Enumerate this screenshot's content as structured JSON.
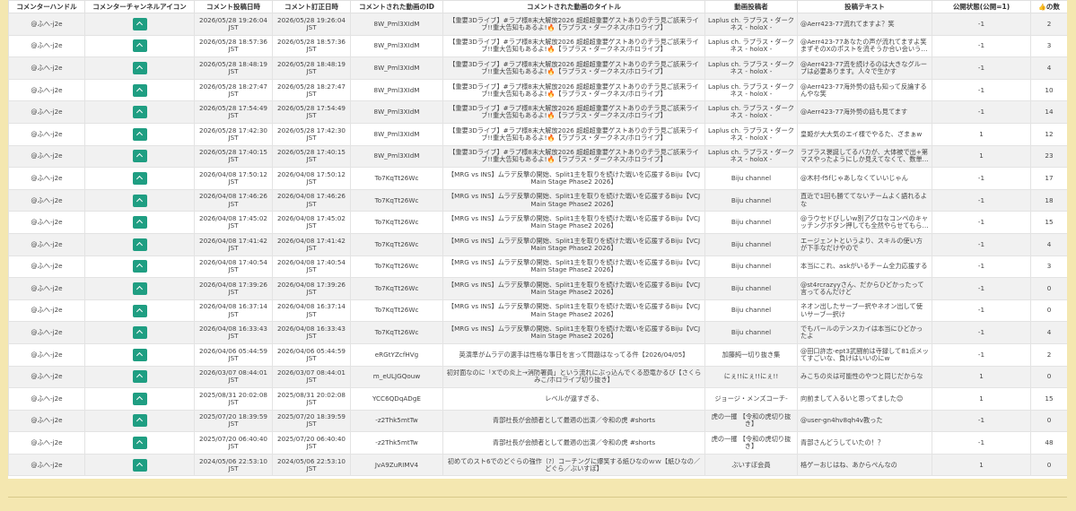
{
  "headers": {
    "handle": "コメンターハンドル",
    "icon": "コメンターチャンネルアイコン",
    "posted": "コメント投稿日時",
    "edited": "コメント訂正日時",
    "video_id": "コメントされた動画のID",
    "video_title": "コメントされた動画のタイトル",
    "uploader": "動画投稿者",
    "text": "投稿テキスト",
    "public": "公開状態(公開=1)",
    "likes_icon": "👍",
    "likes": "の数"
  },
  "rows": [
    {
      "handle": "@ふへ-j2e",
      "posted": "2026/05/28 19:26:04 JST",
      "edited": "2026/05/28 19:26:04 JST",
      "video_id": "8W_Pml3XIdM",
      "video_title": "【重要3Dライブ】#ラプ様8末大解放2026 超超超重要ゲストありのチラ見ご該来ライブ!!重大告知もあるよ!🔥【ラプラス・ダークネス/ホロライブ】",
      "uploader": "Laplus ch. ラプラス・ダークネス - holoX -",
      "text": "@Aerr423-77流れてますよ？笑",
      "public": "-1",
      "likes": "2"
    },
    {
      "handle": "@ふへ-j2e",
      "posted": "2026/05/28 18:57:36 JST",
      "edited": "2026/05/28 18:57:36 JST",
      "video_id": "8W_Pml3XIdM",
      "video_title": "【重要3Dライブ】#ラプ様8末大解放2026 超超超重要ゲストありのチラ見ご該来ライブ!!重大告知もあるよ!🔥【ラプラス・ダークネス/ホロライブ】",
      "uploader": "Laplus ch. ラプラス・ダークネス - holoX -",
      "text": "@Aerr423-77あなたの声が流れてますよ笑　まずそのXのポストを流そうか合い会いうか語さん",
      "public": "-1",
      "likes": "3"
    },
    {
      "handle": "@ふへ-j2e",
      "posted": "2026/05/28 18:48:19 JST",
      "edited": "2026/05/28 18:48:19 JST",
      "video_id": "8W_Pml3XIdM",
      "video_title": "【重要3Dライブ】#ラプ様8末大解放2026 超超超重要ゲストありのチラ見ご該来ライブ!!重大告知もあるよ!🔥【ラプラス・ダークネス/ホロライブ】",
      "uploader": "Laplus ch. ラプラス・ダークネス - holoX -",
      "text": "@Aerr423-77流を続けるのは大きなグループは必要あります。人々で生かす",
      "public": "-1",
      "likes": "4"
    },
    {
      "handle": "@ふへ-j2e",
      "posted": "2026/05/28 18:27:47 JST",
      "edited": "2026/05/28 18:27:47 JST",
      "video_id": "8W_Pml3XIdM",
      "video_title": "【重要3Dライブ】#ラプ様8末大解放2026 超超超重要ゲストありのチラ見ご該来ライブ!!重大告知もあるよ!🔥【ラプラス・ダークネス/ホロライブ】",
      "uploader": "Laplus ch. ラプラス・ダークネス - holoX -",
      "text": "@Aerr423-77海外勢の話も知って反論するんやな笑",
      "public": "-1",
      "likes": "10"
    },
    {
      "handle": "@ふへ-j2e",
      "posted": "2026/05/28 17:54:49 JST",
      "edited": "2026/05/28 17:54:49 JST",
      "video_id": "8W_Pml3XIdM",
      "video_title": "【重要3Dライブ】#ラプ様8末大解放2026 超超超重要ゲストありのチラ見ご該来ライブ!!重大告知もあるよ!🔥【ラプラス・ダークネス/ホロライブ】",
      "uploader": "Laplus ch. ラプラス・ダークネス - holoX -",
      "text": "@Aerr423-77海外勢の話も見てます",
      "public": "-1",
      "likes": "14"
    },
    {
      "handle": "@ふへ-j2e",
      "posted": "2026/05/28 17:42:30 JST",
      "edited": "2026/05/28 17:42:30 JST",
      "video_id": "8W_Pml3XIdM",
      "video_title": "【重要3Dライブ】#ラプ様8末大解放2026 超超超重要ゲストありのチラ見ご該来ライブ!!重大告知もあるよ!🔥【ラプラス・ダークネス/ホロライブ】",
      "uploader": "Laplus ch. ラプラス・ダークネス - holoX -",
      "text": "皇姫が大大気のエイ様でやるた、ざまぁw",
      "public": "1",
      "likes": "12"
    },
    {
      "handle": "@ふへ-j2e",
      "posted": "2026/05/28 17:40:15 JST",
      "edited": "2026/05/28 17:40:15 JST",
      "video_id": "8W_Pml3XIdM",
      "video_title": "【重要3Dライブ】#ラプ様8末大解放2026 超超超重要ゲストありのチラ見ご該来ライブ!!重大告知もあるよ!🔥【ラプラス・ダークネス/ホロライブ】",
      "uploader": "Laplus ch. ラプラス・ダークネス - holoX -",
      "text": "ラプラス褒誕してるバカが、大体被で出+第マスやったようにしか見えてなくて、数単がバカやと信者も知るんやね",
      "public": "1",
      "likes": "23"
    },
    {
      "handle": "@ふへ-j2e",
      "posted": "2026/04/08 17:50:12 JST",
      "edited": "2026/04/08 17:50:12 JST",
      "video_id": "To7KqTt26Wc",
      "video_title": "【MRG vs INS】ムラデ反撃の開始、Split1主を取りを続けた戦いを応援するBiju【VCJ Main Stage Phase2 2026】",
      "uploader": "Biju channel",
      "text": "@木村-f5fじゃあしなくていいじゃん",
      "public": "-1",
      "likes": "17"
    },
    {
      "handle": "@ふへ-j2e",
      "posted": "2026/04/08 17:46:26 JST",
      "edited": "2026/04/08 17:46:26 JST",
      "video_id": "To7KqTt26Wc",
      "video_title": "【MRG vs INS】ムラデ反撃の開始、Split1主を取りを続けた戦いを応援するBiju【VCJ Main Stage Phase2 2026】",
      "uploader": "Biju channel",
      "text": "直近で1回も勝ててないチームよく語れるよな",
      "public": "-1",
      "likes": "18"
    },
    {
      "handle": "@ふへ-j2e",
      "posted": "2026/04/08 17:45:02 JST",
      "edited": "2026/04/08 17:45:02 JST",
      "video_id": "To7KqTt26Wc",
      "video_title": "【MRG vs INS】ムラデ反撃の開始、Split1主を取りを続けた戦いを応援するBiju【VCJ Main Stage Phase2 2026】",
      "uploader": "Biju channel",
      "text": "@ラウセドびしいw別アグロなコンペのキャッチングボタン押しても全然やらせてもらえない",
      "public": "-1",
      "likes": "15"
    },
    {
      "handle": "@ふへ-j2e",
      "posted": "2026/04/08 17:41:42 JST",
      "edited": "2026/04/08 17:41:42 JST",
      "video_id": "To7KqTt26Wc",
      "video_title": "【MRG vs INS】ムラデ反撃の開始、Split1主を取りを続けた戦いを応援するBiju【VCJ Main Stage Phase2 2026】",
      "uploader": "Biju channel",
      "text": "エージェントというより、スキルの使い方が下手なだけやので",
      "public": "-1",
      "likes": "4"
    },
    {
      "handle": "@ふへ-j2e",
      "posted": "2026/04/08 17:40:54 JST",
      "edited": "2026/04/08 17:40:54 JST",
      "video_id": "To7KqTt26Wc",
      "video_title": "【MRG vs INS】ムラデ反撃の開始、Split1主を取りを続けた戦いを応援するBiju【VCJ Main Stage Phase2 2026】",
      "uploader": "Biju channel",
      "text": "本当にこれ、askがいるチーム全力応援する",
      "public": "-1",
      "likes": "3"
    },
    {
      "handle": "@ふへ-j2e",
      "posted": "2026/04/08 17:39:26 JST",
      "edited": "2026/04/08 17:39:26 JST",
      "video_id": "To7KqTt26Wc",
      "video_title": "【MRG vs INS】ムラデ反撃の開始、Split1主を取りを続けた戦いを応援するBiju【VCJ Main Stage Phase2 2026】",
      "uploader": "Biju channel",
      "text": "@st4rcrazyyさん、だからひどかったって言ってるんだけど",
      "public": "-1",
      "likes": "0"
    },
    {
      "handle": "@ふへ-j2e",
      "posted": "2026/04/08 16:37:14 JST",
      "edited": "2026/04/08 16:37:14 JST",
      "video_id": "To7KqTt26Wc",
      "video_title": "【MRG vs INS】ムラデ反撃の開始、Split1主を取りを続けた戦いを応援するBiju【VCJ Main Stage Phase2 2026】",
      "uploader": "Biju channel",
      "text": "ネオン出したサーブ一択やネオン出して使いサーブ一択け",
      "public": "-1",
      "likes": "0"
    },
    {
      "handle": "@ふへ-j2e",
      "posted": "2026/04/08 16:33:43 JST",
      "edited": "2026/04/08 16:33:43 JST",
      "video_id": "To7KqTt26Wc",
      "video_title": "【MRG vs INS】ムラデ反撃の開始、Split1主を取りを続けた戦いを応援するBiju【VCJ Main Stage Phase2 2026】",
      "uploader": "Biju channel",
      "text": "でもパールのテンスカイは本当にひどかったよ",
      "public": "-1",
      "likes": "4"
    },
    {
      "handle": "@ふへ-j2e",
      "posted": "2026/04/06 05:44:59 JST",
      "edited": "2026/04/06 05:44:59 JST",
      "video_id": "eRGtYZcfHVg",
      "video_title": "英演準がムラデの選手は性格な事日を言って問題はなってる件【2026/04/05】",
      "uploader": "加藤純一切り抜き集",
      "text": "@田口許志-ept3武闘前は寺録して81点メッてすごいな、負けはいいのにw",
      "public": "-1",
      "likes": "2"
    },
    {
      "handle": "@ふへ-j2e",
      "posted": "2026/03/07 08:44:01 JST",
      "edited": "2026/03/07 08:44:01 JST",
      "video_id": "m_eULJGQouw",
      "video_title": "初対面なのに「Xでの炎上→消防署員」という流れにぶっ込んでくる恐竜かるび【さくらみこ/ホロライブ切り抜き】",
      "uploader": "にぇ!!にぇ!!にぇ!!",
      "text": "みこちの炎は可能性のやつと同じだからな",
      "public": "1",
      "likes": "0"
    },
    {
      "handle": "@ふへ-j2e",
      "posted": "2025/08/31 20:02:08 JST",
      "edited": "2025/08/31 20:02:08 JST",
      "video_id": "YCC6QDqADgE",
      "video_title": "レベルが違すぎる、",
      "uploader": "ジョージ・メンズコーチ-",
      "text": "向前まして入るいと思ってました😊",
      "public": "1",
      "likes": "15"
    },
    {
      "handle": "@ふへ-j2e",
      "posted": "2025/07/20 18:39:59 JST",
      "edited": "2025/07/20 18:39:59 JST",
      "video_id": "-z2Thk5mtTw",
      "video_title": "青部社長が会顔者として最適の出演／令和の虎 #shorts",
      "uploader": "虎の一攫 【令和の虎切り抜き】",
      "text": "@user-gn4hv8qh4v教った",
      "public": "-1",
      "likes": "0"
    },
    {
      "handle": "@ふへ-j2e",
      "posted": "2025/07/20 06:40:40 JST",
      "edited": "2025/07/20 06:40:40 JST",
      "video_id": "-z2Thk5mtTw",
      "video_title": "青部社長が会顔者として最適の出演／令和の虎 #shorts",
      "uploader": "虎の一攫 【令和の虎切り抜き】",
      "text": "青部さんどうしていたの！？",
      "public": "-1",
      "likes": "48"
    },
    {
      "handle": "@ふへ-j2e",
      "posted": "2024/05/06 22:53:10 JST",
      "edited": "2024/05/06 22:53:10 JST",
      "video_id": "JvA9ZuRIMV4",
      "video_title": "初めてのスト6でのどぐらの強作（?）コーチングに爆笑する紙ひなのｗｗ【紙ひなの／どぐら／ぶいすぽ】",
      "uploader": "ぶいすぽ会員",
      "text": "格ゲーおじはね、あからぺんなの",
      "public": "1",
      "likes": "0"
    }
  ]
}
